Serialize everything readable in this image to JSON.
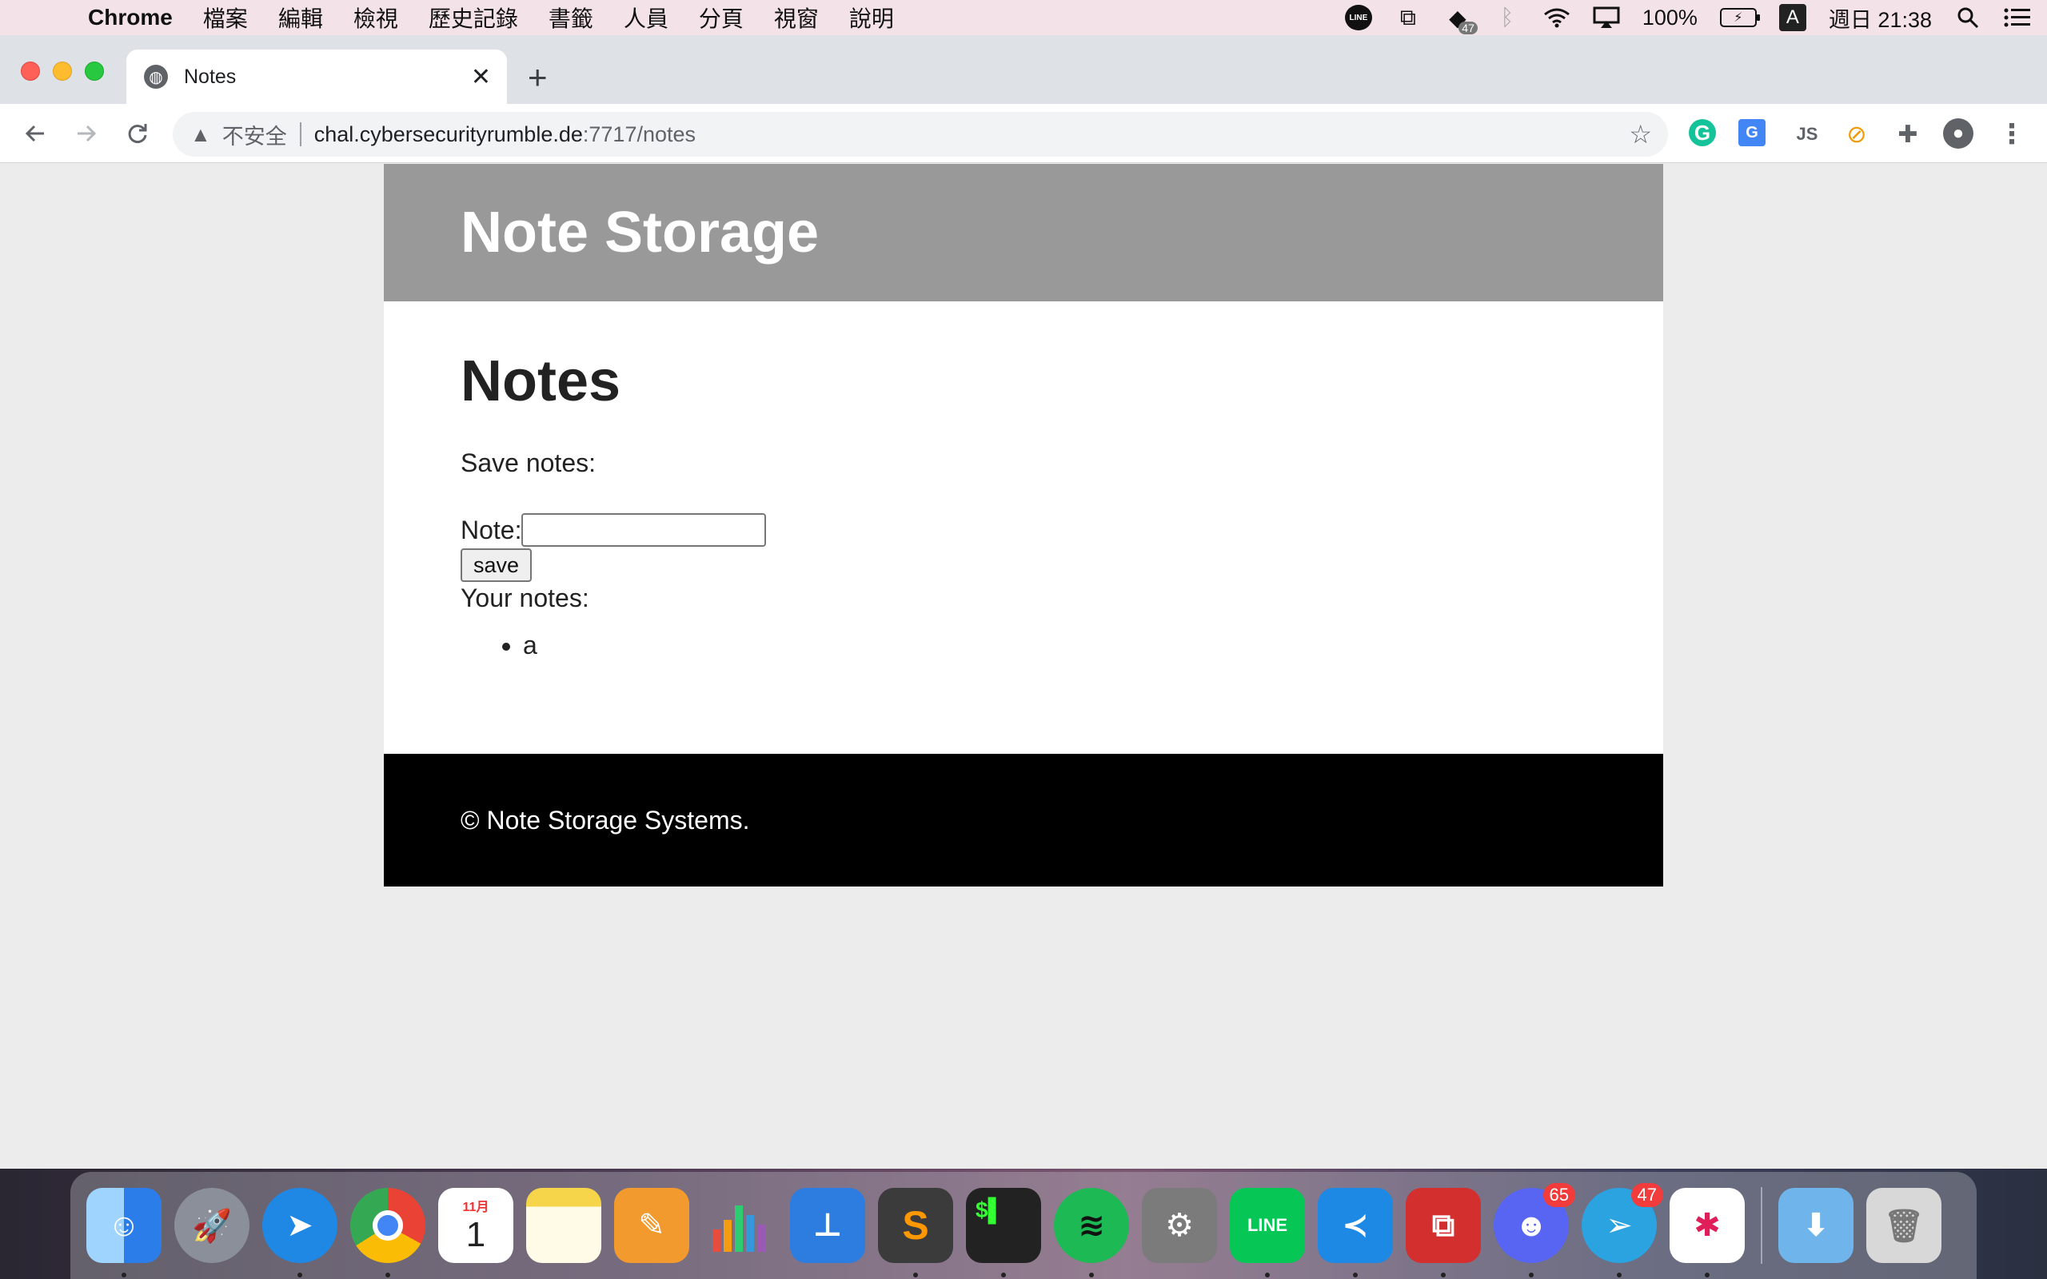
{
  "menubar": {
    "apple_glyph": "",
    "app_name": "Chrome",
    "menus": [
      "檔案",
      "編輯",
      "檢視",
      "歷史記錄",
      "書籤",
      "人員",
      "分頁",
      "視窗",
      "說明"
    ],
    "line_label": "LINE",
    "badge_count": "47",
    "battery": "100%",
    "input_method": "A",
    "clock": "週日 21:38"
  },
  "tab": {
    "title": "Notes",
    "close_glyph": "✕",
    "new_tab_glyph": "+"
  },
  "toolbar": {
    "insecure_label": "不安全",
    "url_host": "chal.cybersecurityrumble.de",
    "url_path": ":7717/notes"
  },
  "page": {
    "site_title": "Note Storage",
    "heading": "Notes",
    "save_intro": "Save notes:",
    "note_label": "Note:",
    "note_value": "",
    "save_button": "save",
    "your_notes_label": "Your notes:",
    "notes": [
      "a"
    ],
    "footer": "© Note Storage Systems."
  },
  "dock": {
    "items": [
      {
        "name": "Finder",
        "color": "#3a8ee6"
      },
      {
        "name": "Launchpad",
        "color": "#8a8f99"
      },
      {
        "name": "Safari",
        "color": "#1f88e5"
      },
      {
        "name": "Chrome",
        "color": "#e8453c"
      },
      {
        "name": "Calendar",
        "color": "#ffffff"
      },
      {
        "name": "Notes",
        "color": "#f7d54a"
      },
      {
        "name": "Pages",
        "color": "#f29a2e"
      },
      {
        "name": "Numbers",
        "color": "#ffffff"
      },
      {
        "name": "Keynote",
        "color": "#2d7de0"
      },
      {
        "name": "Sublime Text",
        "color": "#3b3b3b"
      },
      {
        "name": "Terminal",
        "color": "#222222"
      },
      {
        "name": "Spotify",
        "color": "#1db954"
      },
      {
        "name": "System Preferences",
        "color": "#7b7b7b"
      },
      {
        "name": "LINE",
        "color": "#06c755"
      },
      {
        "name": "VS Code",
        "color": "#1e88e5"
      },
      {
        "name": "Parallels",
        "color": "#d32f2f"
      },
      {
        "name": "Discord",
        "color": "#5865f2"
      },
      {
        "name": "Telegram",
        "color": "#2aa3e0"
      },
      {
        "name": "Slack",
        "color": "#ffffff"
      },
      {
        "name": "Downloads",
        "color": "#6fb4ea"
      },
      {
        "name": "Trash",
        "color": "#d8d8d8"
      }
    ],
    "calendar_month": "11月",
    "calendar_day": "1",
    "line_label": "LINE",
    "discord_badge": "65",
    "telegram_badge": "47"
  }
}
